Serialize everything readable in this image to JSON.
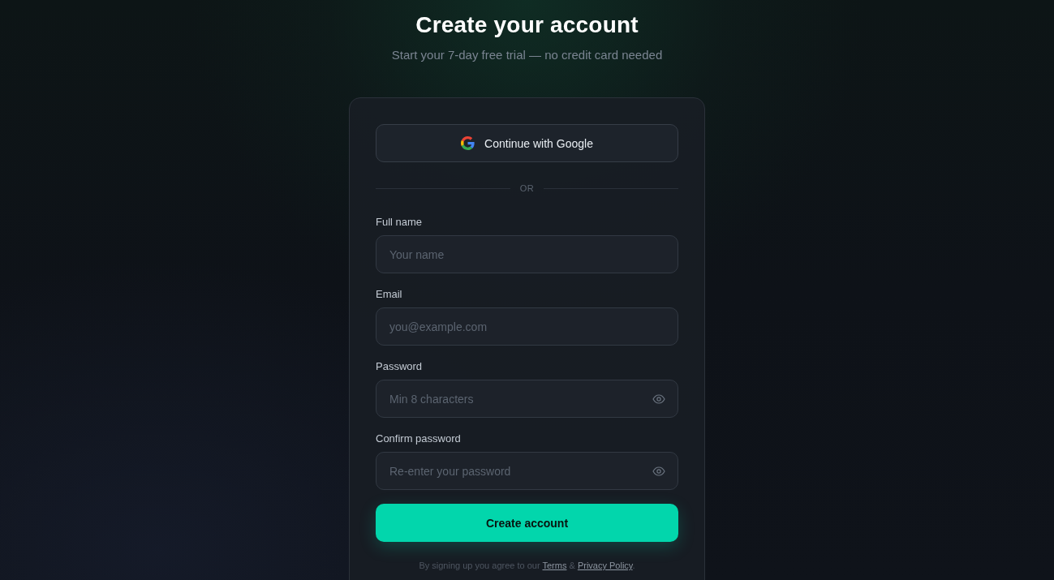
{
  "header": {
    "title": "Create your account",
    "subtitle": "Start your 7-day free trial — no credit card needed"
  },
  "oauth_button": {
    "label": "Continue with Google"
  },
  "divider": {
    "label": "OR"
  },
  "fields": [
    {
      "kind": "text",
      "label": "Full name",
      "placeholder": "Your name"
    },
    {
      "kind": "email",
      "label": "Email",
      "placeholder": "you@example.com"
    },
    {
      "kind": "password",
      "label": "Password",
      "placeholder": "Min 8 characters"
    },
    {
      "kind": "password",
      "label": "Confirm password",
      "placeholder": "Re-enter your password"
    }
  ],
  "submit_button": {
    "label": "Create account"
  },
  "legal": [
    {
      "kind": "text",
      "text": "By signing up you agree to our "
    },
    {
      "kind": "link",
      "text": "Terms"
    },
    {
      "kind": "text",
      "text": " & "
    },
    {
      "kind": "link",
      "text": "Privacy Policy"
    },
    {
      "kind": "text",
      "text": "."
    }
  ]
}
